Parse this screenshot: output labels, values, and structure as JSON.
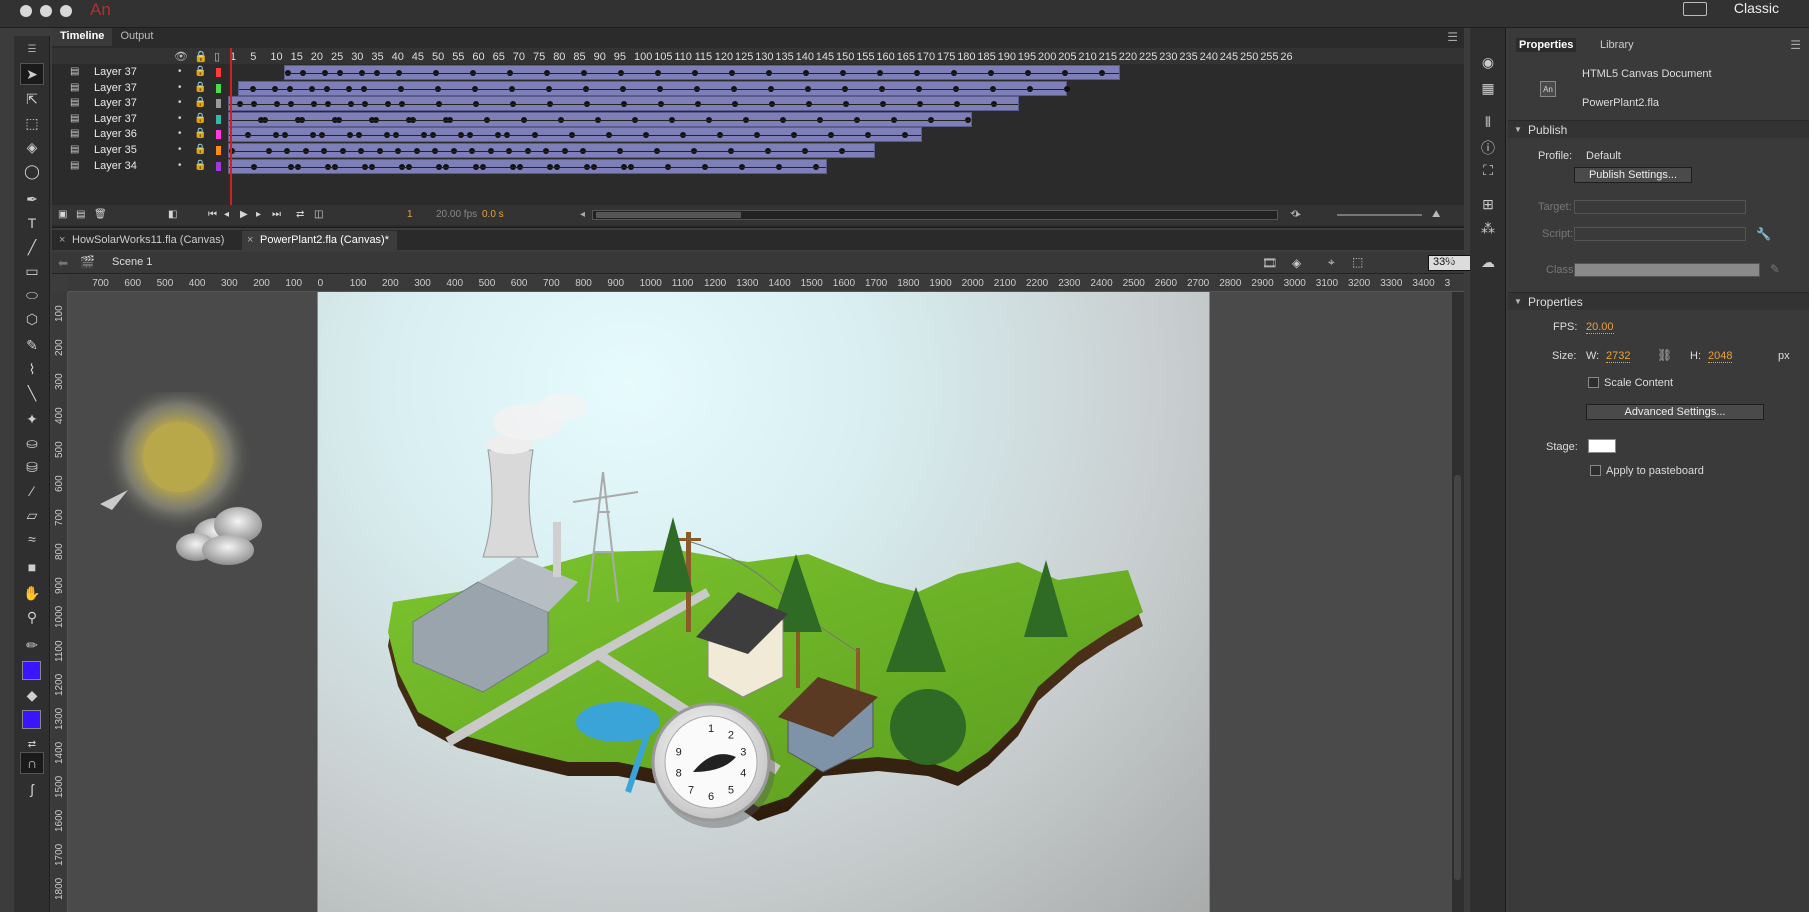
{
  "app": {
    "logo_text": "An",
    "workspace": "Classic"
  },
  "timeline": {
    "tabs": [
      "Timeline",
      "Output"
    ],
    "frame_numbers": [
      "1",
      "5",
      "10",
      "15",
      "20",
      "25",
      "30",
      "35",
      "40",
      "45",
      "50",
      "55",
      "60",
      "65",
      "70",
      "75",
      "80",
      "85",
      "90",
      "95",
      "100",
      "105",
      "110",
      "115",
      "120",
      "125",
      "130",
      "135",
      "140",
      "145",
      "150",
      "155",
      "160",
      "165",
      "170",
      "175",
      "180",
      "185",
      "190",
      "195",
      "200",
      "205",
      "210",
      "215",
      "220",
      "225",
      "230",
      "235",
      "240",
      "245",
      "250",
      "255",
      "26"
    ],
    "layers": [
      {
        "name": "Layer 37",
        "color": "#ff3a3a"
      },
      {
        "name": "Layer 37",
        "color": "#4cd94c"
      },
      {
        "name": "Layer 37",
        "color": "#9a9a9a"
      },
      {
        "name": "Layer 37",
        "color": "#3ab7a4"
      },
      {
        "name": "Layer 36",
        "color": "#ff3ae0"
      },
      {
        "name": "Layer 35",
        "color": "#ff8a1a"
      },
      {
        "name": "Layer 34",
        "color": "#a13ad9"
      }
    ],
    "current_frame": "1",
    "fps": "20.00 fps",
    "time": "0.0 s"
  },
  "documents": {
    "tabs": [
      "HowSolarWorks11.fla (Canvas)",
      "PowerPlant2.fla (Canvas)*"
    ],
    "scene": "Scene 1",
    "zoom": "33%"
  },
  "rulers": {
    "horizontal": [
      "0",
      "700",
      "600",
      "500",
      "400",
      "300",
      "200",
      "100",
      "0",
      "100",
      "200",
      "300",
      "400",
      "500",
      "600",
      "700",
      "800",
      "900",
      "1000",
      "1100",
      "1200",
      "1300",
      "1400",
      "1500",
      "1600",
      "1700",
      "1800",
      "1900",
      "2000",
      "2100",
      "2200",
      "2300",
      "2400",
      "2500",
      "2600",
      "2700",
      "2800",
      "2900",
      "3000",
      "3100",
      "3200",
      "3300",
      "3400",
      "3"
    ],
    "vertical": [
      "100",
      "200",
      "300",
      "400",
      "500",
      "600",
      "700",
      "800",
      "900",
      "1000",
      "1100",
      "1200",
      "1300",
      "1400",
      "1500",
      "1600",
      "1700",
      "1800"
    ]
  },
  "properties": {
    "tabs": [
      "Properties",
      "Library"
    ],
    "doc_type": "HTML5 Canvas Document",
    "doc_icon_text": "An",
    "file_name": "PowerPlant2.fla",
    "publish": {
      "section": "Publish",
      "profile_label": "Profile:",
      "profile_value": "Default",
      "settings_button": "Publish Settings...",
      "target_label": "Target:",
      "script_label": "Script:",
      "class_label": "Class:"
    },
    "props": {
      "section": "Properties",
      "fps_label": "FPS:",
      "fps_value": "20.00",
      "size_label": "Size:",
      "w_label": "W:",
      "w_value": "2732",
      "h_label": "H:",
      "h_value": "2048",
      "unit": "px",
      "scale_content": "Scale Content",
      "advanced_button": "Advanced Settings...",
      "stage_label": "Stage:",
      "stage_color": "#ffffff",
      "apply_pasteboard": "Apply to pasteboard"
    }
  },
  "stage_art": {
    "gauge_numbers": [
      "1",
      "2",
      "3",
      "4",
      "5",
      "6",
      "7",
      "8",
      "9"
    ]
  }
}
